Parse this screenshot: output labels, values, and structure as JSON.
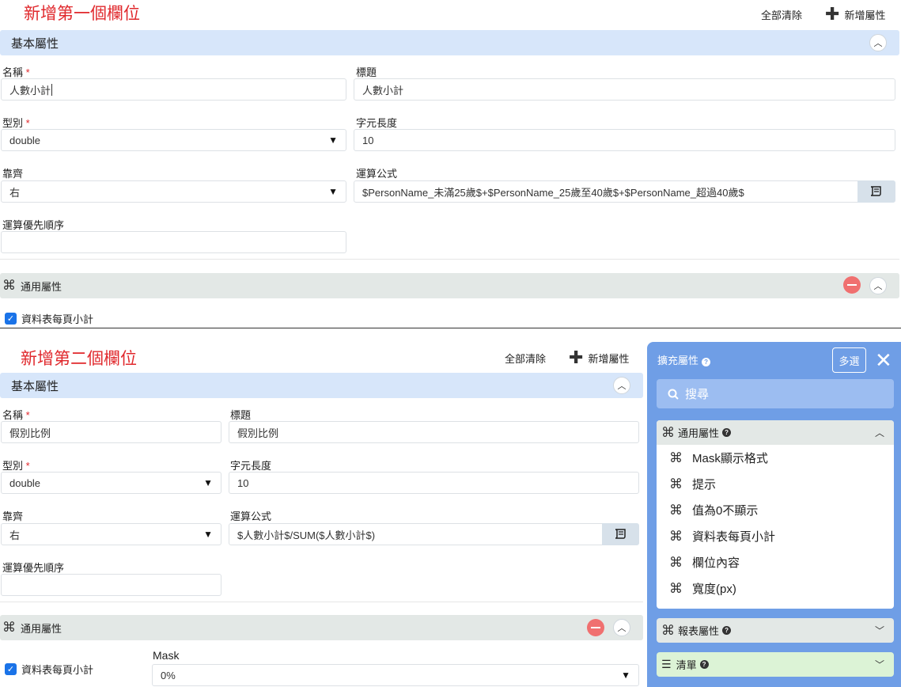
{
  "section1": {
    "heading": "新增第一個欄位",
    "clear_all": "全部清除",
    "add_attr": "新增屬性",
    "basic_title": "基本屬性",
    "name_label": "名稱",
    "name_value": "人數小計",
    "title_label": "標題",
    "title_value": "人數小計",
    "type_label": "型別",
    "type_value": "double",
    "charlen_label": "字元長度",
    "charlen_value": "10",
    "align_label": "靠齊",
    "align_value": "右",
    "formula_label": "運算公式",
    "formula_value": "$PersonName_未滿25歲$+$PersonName_25歲至40歲$+$PersonName_超過40歲$",
    "priority_label": "運算優先順序",
    "priority_value": "",
    "common_title": "通用屬性",
    "subtotal_label": "資料表每頁小計"
  },
  "section2": {
    "heading": "新增第二個欄位",
    "clear_all": "全部清除",
    "add_attr": "新增屬性",
    "basic_title": "基本屬性",
    "name_label": "名稱",
    "name_value": "假別比例",
    "title_label": "標題",
    "title_value": "假別比例",
    "type_label": "型別",
    "type_value": "double",
    "charlen_label": "字元長度",
    "charlen_value": "10",
    "align_label": "靠齊",
    "align_value": "右",
    "formula_label": "運算公式",
    "formula_value": "$人數小計$/SUM($人數小計$)",
    "priority_label": "運算優先順序",
    "priority_value": "",
    "common_title": "通用屬性",
    "subtotal_label": "資料表每頁小計",
    "mask_label": "Mask",
    "mask_value": "0%"
  },
  "panel": {
    "title": "擴充屬性",
    "multi_select": "多選",
    "search_placeholder": "搜尋",
    "groups": [
      {
        "title": "通用屬性",
        "items": [
          "Mask顯示格式",
          "提示",
          "值為0不顯示",
          "資料表每頁小計",
          "欄位內容",
          "寬度(px)"
        ]
      },
      {
        "title": "報表屬性"
      },
      {
        "title": "清單"
      }
    ]
  },
  "colors": {
    "accent_red": "#e0282c",
    "panel_blue": "#6f9ee6",
    "section_blue": "#d7e6fa",
    "section_gray": "#e3e8e6"
  },
  "icons": [
    "plus-icon",
    "chevron-up-icon",
    "chevron-down-icon",
    "command-icon",
    "formula-icon",
    "remove-icon",
    "search-icon",
    "close-icon",
    "help-icon",
    "list-icon",
    "checkbox-icon"
  ]
}
